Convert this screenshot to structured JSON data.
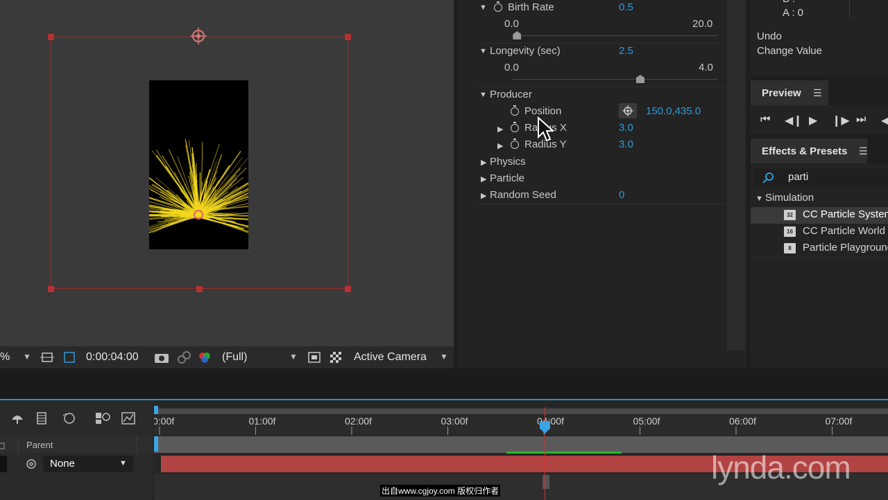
{
  "viewer": {
    "zoom_suffix": "%",
    "timecode": "0:00:04:00",
    "resolution": "(Full)",
    "camera": "Active Camera"
  },
  "effect_controls": {
    "birth_rate": {
      "label": "Birth Rate",
      "value": "0.5",
      "min": "0.0",
      "max": "20.0",
      "fraction": 0.025
    },
    "longevity": {
      "label": "Longevity (sec)",
      "value": "2.5",
      "min": "0.0",
      "max": "4.0",
      "fraction": 0.625
    },
    "producer": {
      "label": "Producer",
      "position": {
        "label": "Position",
        "value": "150.0,435.0"
      },
      "radius_x": {
        "label": "Radius X",
        "value": "3.0"
      },
      "radius_y": {
        "label": "Radius Y",
        "value": "3.0"
      }
    },
    "physics": {
      "label": "Physics"
    },
    "particle": {
      "label": "Particle"
    },
    "random_seed": {
      "label": "Random Seed",
      "value": "0"
    }
  },
  "info": {
    "b_label": "B :",
    "a_label": "A : 0",
    "undo": "Undo",
    "change_value": "Change Value"
  },
  "preview": {
    "title": "Preview"
  },
  "effects_presets": {
    "title": "Effects & Presets",
    "search_value": "parti",
    "category": "Simulation",
    "items": [
      {
        "label": "CC Particle Systems II",
        "badge": "32"
      },
      {
        "label": "CC Particle World",
        "badge": "16"
      },
      {
        "label": "Particle Playground",
        "badge": "8"
      }
    ]
  },
  "timeline": {
    "parent_header": "Parent",
    "parent_value": "None",
    "ticks": [
      "0:00f",
      "01:00f",
      "02:00f",
      "03:00f",
      "04:00f",
      "05:00f",
      "06:00f",
      "07:00f"
    ]
  },
  "watermark": {
    "logo": "lynda.com",
    "caption": "出自www.cgjoy.com 版权归作者"
  },
  "colors": {
    "accent_blue": "#2d9bd8",
    "layer_bar": "#b24343",
    "cti_red": "#d23030",
    "particle_yellow": "#f2d81e"
  }
}
